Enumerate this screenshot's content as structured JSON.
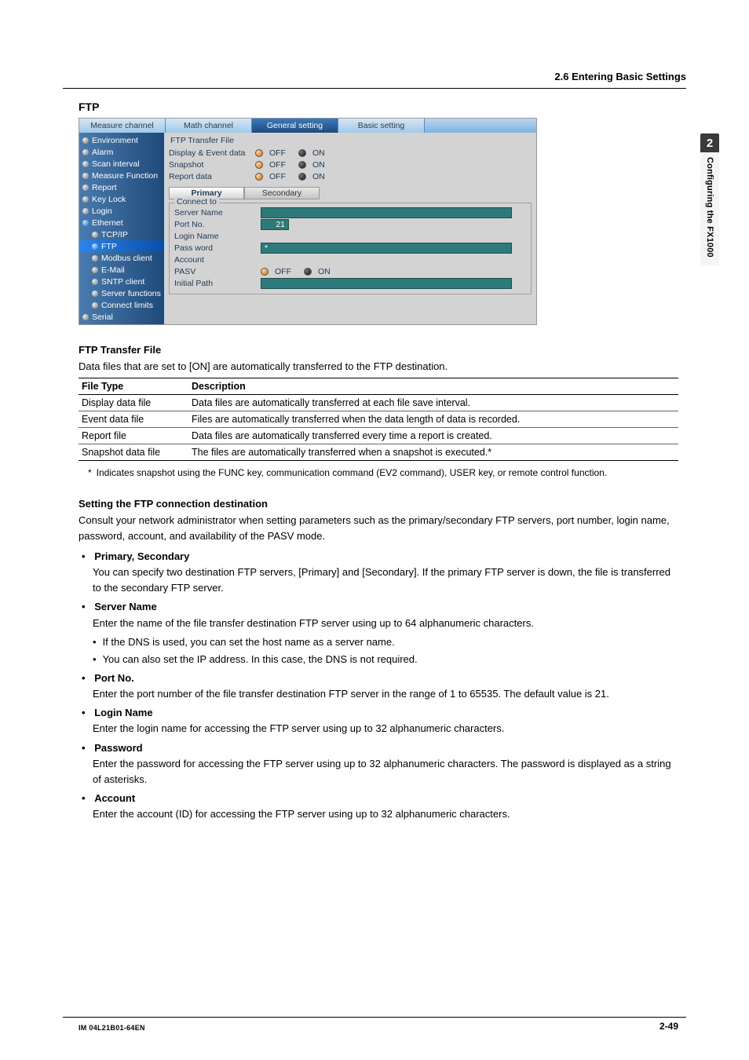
{
  "header": {
    "section": "2.6  Entering Basic Settings"
  },
  "sideTab": {
    "num": "2",
    "label": "Configuring the FX1000"
  },
  "section_title": "FTP",
  "tabs": [
    {
      "label": "Measure channel"
    },
    {
      "label": "Math channel"
    },
    {
      "label": "General setting",
      "active": true
    },
    {
      "label": "Basic setting"
    }
  ],
  "nav": [
    {
      "label": "Environment"
    },
    {
      "label": "Alarm"
    },
    {
      "label": "Scan interval"
    },
    {
      "label": "Measure Function"
    },
    {
      "label": "Report"
    },
    {
      "label": "Key Lock"
    },
    {
      "label": "Login"
    },
    {
      "label": "Ethernet",
      "expanded": true
    },
    {
      "label": "TCP/IP",
      "indent": 1
    },
    {
      "label": "FTP",
      "indent": 1,
      "selected": true
    },
    {
      "label": "Modbus client",
      "indent": 1
    },
    {
      "label": "E-Mail",
      "indent": 1
    },
    {
      "label": "SNTP client",
      "indent": 1
    },
    {
      "label": "Server functions",
      "indent": 1
    },
    {
      "label": "Connect limits",
      "indent": 1
    },
    {
      "label": "Serial"
    }
  ],
  "panel": {
    "transfer_group_title": "FTP Transfer File",
    "rows": [
      {
        "label": "Display & Event data",
        "off": "OFF",
        "on": "ON"
      },
      {
        "label": "Snapshot",
        "off": "OFF",
        "on": "ON"
      },
      {
        "label": "Report data",
        "off": "OFF",
        "on": "ON"
      }
    ],
    "subtabs": [
      {
        "label": "Primary",
        "active": true
      },
      {
        "label": "Secondary"
      }
    ],
    "connect_legend": "Connect to",
    "fields": {
      "server_name": {
        "label": "Server Name",
        "value": ""
      },
      "port": {
        "label": "Port No.",
        "value": "21"
      },
      "login": {
        "label": "Login Name",
        "value": ""
      },
      "password": {
        "label": "Pass word",
        "value": "*"
      },
      "account": {
        "label": "Account",
        "value": ""
      },
      "pasv": {
        "label": "PASV",
        "off": "OFF",
        "on": "ON"
      },
      "initial": {
        "label": "Initial Path",
        "value": ""
      }
    }
  },
  "transfer": {
    "heading": "FTP Transfer File",
    "intro": "Data files that are set to [ON] are automatically transferred to the FTP destination.",
    "th1": "File Type",
    "th2": "Description",
    "rows": [
      {
        "a": "Display data file",
        "b": "Data files are automatically transferred at each file save interval."
      },
      {
        "a": "Event data file",
        "b": "Files are automatically transferred when the data length of data is recorded."
      },
      {
        "a": "Report file",
        "b": "Data files are automatically transferred every time a report is created."
      },
      {
        "a": "Snapshot data file",
        "b": "The files are automatically transferred when a snapshot is executed.*"
      }
    ],
    "note": "Indicates snapshot using the FUNC key, communication command (EV2 command), USER key, or remote control function."
  },
  "conn": {
    "heading": "Setting the FTP connection destination",
    "intro": "Consult your network administrator when setting parameters such as the primary/secondary FTP servers, port number, login name, password, account, and availability of the PASV mode.",
    "items": [
      {
        "t": "Primary, Secondary",
        "d": "You can specify two destination FTP servers, [Primary] and [Secondary].  If the primary FTP server is down, the file is transferred to the secondary FTP server."
      },
      {
        "t": "Server Name",
        "d": "Enter the name of the file transfer destination FTP server using up to 64 alphanumeric characters.",
        "sub": [
          "If the DNS is used, you can set the host name as a server name.",
          "You can also set the IP address.  In this case, the DNS is not required."
        ]
      },
      {
        "t": "Port No.",
        "d": "Enter the port number of the file transfer destination FTP server in the range of 1 to 65535.  The default value is 21."
      },
      {
        "t": "Login Name",
        "d": "Enter the login name for accessing the FTP server using up to 32 alphanumeric characters."
      },
      {
        "t": "Password",
        "d": "Enter the password for accessing the FTP server using up to 32 alphanumeric characters. The password is displayed as a string of asterisks."
      },
      {
        "t": "Account",
        "d": "Enter the account (ID) for accessing the FTP server using up to 32 alphanumeric characters."
      }
    ]
  },
  "footer": {
    "left": "IM 04L21B01-64EN",
    "right": "2-49"
  }
}
